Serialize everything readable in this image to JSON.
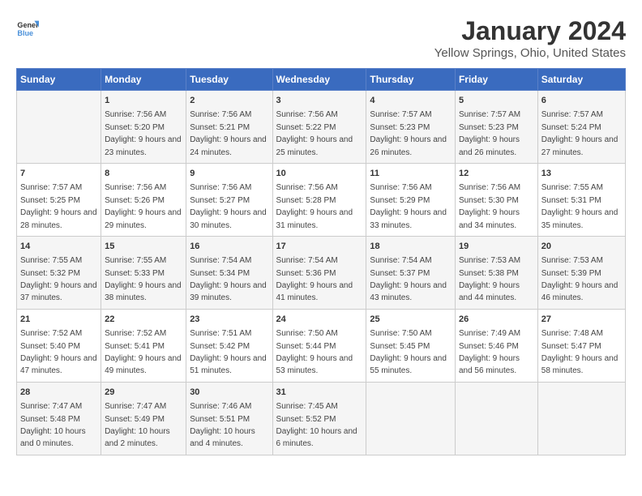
{
  "header": {
    "logo_general": "General",
    "logo_blue": "Blue",
    "title": "January 2024",
    "subtitle": "Yellow Springs, Ohio, United States"
  },
  "days": [
    "Sunday",
    "Monday",
    "Tuesday",
    "Wednesday",
    "Thursday",
    "Friday",
    "Saturday"
  ],
  "weeks": [
    [
      {
        "date": "",
        "sunrise": "",
        "sunset": "",
        "daylight": ""
      },
      {
        "date": "1",
        "sunrise": "Sunrise: 7:56 AM",
        "sunset": "Sunset: 5:20 PM",
        "daylight": "Daylight: 9 hours and 23 minutes."
      },
      {
        "date": "2",
        "sunrise": "Sunrise: 7:56 AM",
        "sunset": "Sunset: 5:21 PM",
        "daylight": "Daylight: 9 hours and 24 minutes."
      },
      {
        "date": "3",
        "sunrise": "Sunrise: 7:56 AM",
        "sunset": "Sunset: 5:22 PM",
        "daylight": "Daylight: 9 hours and 25 minutes."
      },
      {
        "date": "4",
        "sunrise": "Sunrise: 7:57 AM",
        "sunset": "Sunset: 5:23 PM",
        "daylight": "Daylight: 9 hours and 26 minutes."
      },
      {
        "date": "5",
        "sunrise": "Sunrise: 7:57 AM",
        "sunset": "Sunset: 5:23 PM",
        "daylight": "Daylight: 9 hours and 26 minutes."
      },
      {
        "date": "6",
        "sunrise": "Sunrise: 7:57 AM",
        "sunset": "Sunset: 5:24 PM",
        "daylight": "Daylight: 9 hours and 27 minutes."
      }
    ],
    [
      {
        "date": "7",
        "sunrise": "Sunrise: 7:57 AM",
        "sunset": "Sunset: 5:25 PM",
        "daylight": "Daylight: 9 hours and 28 minutes."
      },
      {
        "date": "8",
        "sunrise": "Sunrise: 7:56 AM",
        "sunset": "Sunset: 5:26 PM",
        "daylight": "Daylight: 9 hours and 29 minutes."
      },
      {
        "date": "9",
        "sunrise": "Sunrise: 7:56 AM",
        "sunset": "Sunset: 5:27 PM",
        "daylight": "Daylight: 9 hours and 30 minutes."
      },
      {
        "date": "10",
        "sunrise": "Sunrise: 7:56 AM",
        "sunset": "Sunset: 5:28 PM",
        "daylight": "Daylight: 9 hours and 31 minutes."
      },
      {
        "date": "11",
        "sunrise": "Sunrise: 7:56 AM",
        "sunset": "Sunset: 5:29 PM",
        "daylight": "Daylight: 9 hours and 33 minutes."
      },
      {
        "date": "12",
        "sunrise": "Sunrise: 7:56 AM",
        "sunset": "Sunset: 5:30 PM",
        "daylight": "Daylight: 9 hours and 34 minutes."
      },
      {
        "date": "13",
        "sunrise": "Sunrise: 7:55 AM",
        "sunset": "Sunset: 5:31 PM",
        "daylight": "Daylight: 9 hours and 35 minutes."
      }
    ],
    [
      {
        "date": "14",
        "sunrise": "Sunrise: 7:55 AM",
        "sunset": "Sunset: 5:32 PM",
        "daylight": "Daylight: 9 hours and 37 minutes."
      },
      {
        "date": "15",
        "sunrise": "Sunrise: 7:55 AM",
        "sunset": "Sunset: 5:33 PM",
        "daylight": "Daylight: 9 hours and 38 minutes."
      },
      {
        "date": "16",
        "sunrise": "Sunrise: 7:54 AM",
        "sunset": "Sunset: 5:34 PM",
        "daylight": "Daylight: 9 hours and 39 minutes."
      },
      {
        "date": "17",
        "sunrise": "Sunrise: 7:54 AM",
        "sunset": "Sunset: 5:36 PM",
        "daylight": "Daylight: 9 hours and 41 minutes."
      },
      {
        "date": "18",
        "sunrise": "Sunrise: 7:54 AM",
        "sunset": "Sunset: 5:37 PM",
        "daylight": "Daylight: 9 hours and 43 minutes."
      },
      {
        "date": "19",
        "sunrise": "Sunrise: 7:53 AM",
        "sunset": "Sunset: 5:38 PM",
        "daylight": "Daylight: 9 hours and 44 minutes."
      },
      {
        "date": "20",
        "sunrise": "Sunrise: 7:53 AM",
        "sunset": "Sunset: 5:39 PM",
        "daylight": "Daylight: 9 hours and 46 minutes."
      }
    ],
    [
      {
        "date": "21",
        "sunrise": "Sunrise: 7:52 AM",
        "sunset": "Sunset: 5:40 PM",
        "daylight": "Daylight: 9 hours and 47 minutes."
      },
      {
        "date": "22",
        "sunrise": "Sunrise: 7:52 AM",
        "sunset": "Sunset: 5:41 PM",
        "daylight": "Daylight: 9 hours and 49 minutes."
      },
      {
        "date": "23",
        "sunrise": "Sunrise: 7:51 AM",
        "sunset": "Sunset: 5:42 PM",
        "daylight": "Daylight: 9 hours and 51 minutes."
      },
      {
        "date": "24",
        "sunrise": "Sunrise: 7:50 AM",
        "sunset": "Sunset: 5:44 PM",
        "daylight": "Daylight: 9 hours and 53 minutes."
      },
      {
        "date": "25",
        "sunrise": "Sunrise: 7:50 AM",
        "sunset": "Sunset: 5:45 PM",
        "daylight": "Daylight: 9 hours and 55 minutes."
      },
      {
        "date": "26",
        "sunrise": "Sunrise: 7:49 AM",
        "sunset": "Sunset: 5:46 PM",
        "daylight": "Daylight: 9 hours and 56 minutes."
      },
      {
        "date": "27",
        "sunrise": "Sunrise: 7:48 AM",
        "sunset": "Sunset: 5:47 PM",
        "daylight": "Daylight: 9 hours and 58 minutes."
      }
    ],
    [
      {
        "date": "28",
        "sunrise": "Sunrise: 7:47 AM",
        "sunset": "Sunset: 5:48 PM",
        "daylight": "Daylight: 10 hours and 0 minutes."
      },
      {
        "date": "29",
        "sunrise": "Sunrise: 7:47 AM",
        "sunset": "Sunset: 5:49 PM",
        "daylight": "Daylight: 10 hours and 2 minutes."
      },
      {
        "date": "30",
        "sunrise": "Sunrise: 7:46 AM",
        "sunset": "Sunset: 5:51 PM",
        "daylight": "Daylight: 10 hours and 4 minutes."
      },
      {
        "date": "31",
        "sunrise": "Sunrise: 7:45 AM",
        "sunset": "Sunset: 5:52 PM",
        "daylight": "Daylight: 10 hours and 6 minutes."
      },
      {
        "date": "",
        "sunrise": "",
        "sunset": "",
        "daylight": ""
      },
      {
        "date": "",
        "sunrise": "",
        "sunset": "",
        "daylight": ""
      },
      {
        "date": "",
        "sunrise": "",
        "sunset": "",
        "daylight": ""
      }
    ]
  ]
}
